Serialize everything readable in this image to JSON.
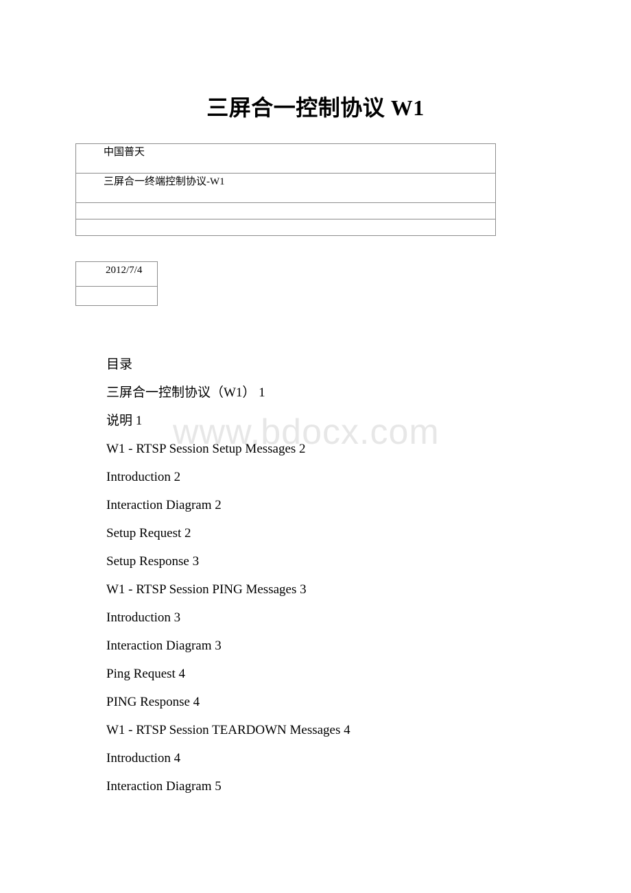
{
  "document": {
    "title": "三屏合一控制协议 W1"
  },
  "info_table": {
    "rows": [
      {
        "text": "中国普天"
      },
      {
        "text": "三屏合一终端控制协议-W1"
      },
      {
        "text": ""
      },
      {
        "text": ""
      }
    ]
  },
  "date_table": {
    "rows": [
      {
        "text": "2012/7/4"
      },
      {
        "text": ""
      }
    ]
  },
  "watermark": {
    "text": "www.bdocx.com",
    "color": "#e7e7e7"
  },
  "toc": {
    "heading": "目录",
    "items": [
      {
        "label": "三屏合一控制协议（W1） 1"
      },
      {
        "label": "说明 1"
      },
      {
        "label": "W1 - RTSP Session Setup Messages 2"
      },
      {
        "label": "Introduction 2"
      },
      {
        "label": "Interaction Diagram 2"
      },
      {
        "label": "Setup Request 2"
      },
      {
        "label": "Setup Response 3"
      },
      {
        "label": "W1 - RTSP Session PING Messages 3"
      },
      {
        "label": "Introduction 3"
      },
      {
        "label": "Interaction Diagram 3"
      },
      {
        "label": "Ping Request 4"
      },
      {
        "label": "PING Response 4"
      },
      {
        "label": "W1 - RTSP Session TEARDOWN Messages 4"
      },
      {
        "label": "Introduction 4"
      },
      {
        "label": "Interaction Diagram 5"
      }
    ]
  }
}
